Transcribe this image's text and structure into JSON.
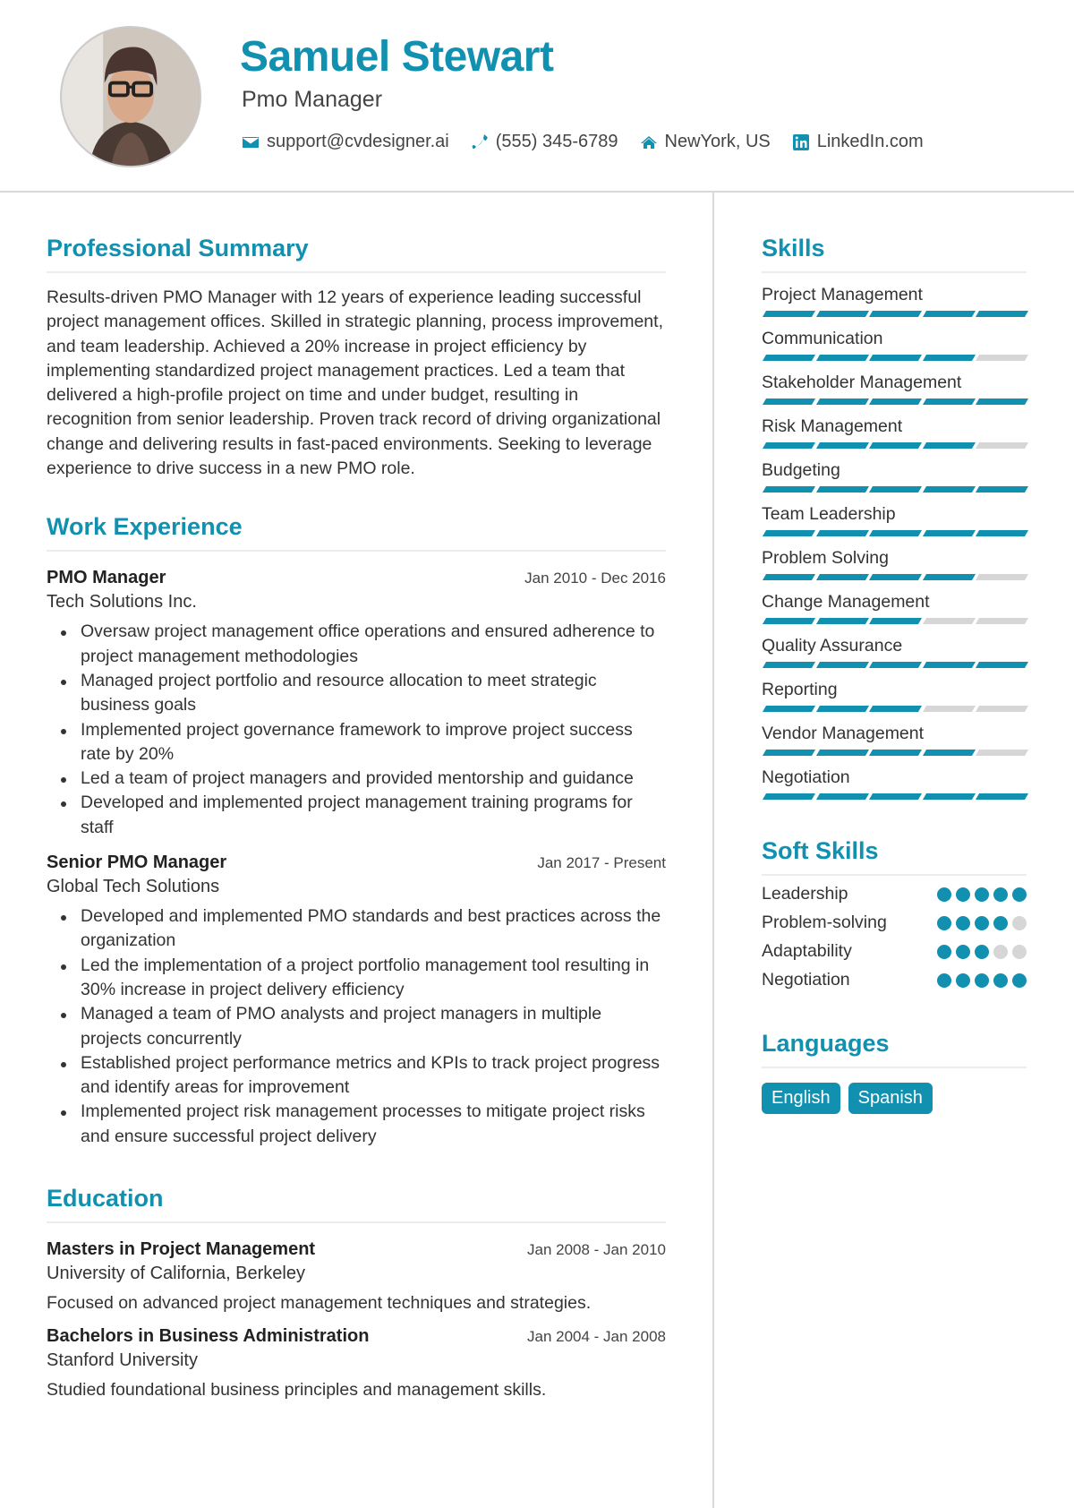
{
  "header": {
    "name": "Samuel Stewart",
    "title": "Pmo Manager",
    "contacts": [
      {
        "icon": "envelope-icon",
        "text": "support@cvdesigner.ai"
      },
      {
        "icon": "phone-icon",
        "text": "(555) 345-6789"
      },
      {
        "icon": "home-icon",
        "text": "NewYork, US"
      },
      {
        "icon": "linkedin-icon",
        "text": "LinkedIn.com"
      }
    ]
  },
  "colors": {
    "accent": "#1190b0",
    "inactive": "#d6d6d6"
  },
  "summary": {
    "heading": "Professional Summary",
    "text": "Results-driven PMO Manager with 12 years of experience leading successful project management offices. Skilled in strategic planning, process improvement, and team leadership. Achieved a 20% increase in project efficiency by implementing standardized project management practices. Led a team that delivered a high-profile project on time and under budget, resulting in recognition from senior leadership. Proven track record of driving organizational change and delivering results in fast-paced environments. Seeking to leverage experience to drive success in a new PMO role."
  },
  "experience": {
    "heading": "Work Experience",
    "jobs": [
      {
        "title": "PMO Manager",
        "date": "Jan 2010 - Dec 2016",
        "company": "Tech Solutions Inc.",
        "bullets": [
          "Oversaw project management office operations and ensured adherence to project management methodologies",
          "Managed project portfolio and resource allocation to meet strategic business goals",
          "Implemented project governance framework to improve project success rate by 20%",
          "Led a team of project managers and provided mentorship and guidance",
          "Developed and implemented project management training programs for staff"
        ]
      },
      {
        "title": "Senior PMO Manager",
        "date": "Jan 2017 - Present",
        "company": "Global Tech Solutions",
        "bullets": [
          "Developed and implemented PMO standards and best practices across the organization",
          "Led the implementation of a project portfolio management tool resulting in 30% increase in project delivery efficiency",
          "Managed a team of PMO analysts and project managers in multiple projects concurrently",
          "Established project performance metrics and KPIs to track project progress and identify areas for improvement",
          "Implemented project risk management processes to mitigate project risks and ensure successful project delivery"
        ]
      }
    ]
  },
  "education": {
    "heading": "Education",
    "items": [
      {
        "degree": "Masters in Project Management",
        "date": "Jan 2008 - Jan 2010",
        "school": "University of California, Berkeley",
        "desc": "Focused on advanced project management techniques and strategies."
      },
      {
        "degree": "Bachelors in Business Administration",
        "date": "Jan 2004 - Jan 2008",
        "school": "Stanford University",
        "desc": "Studied foundational business principles and management skills."
      }
    ]
  },
  "skills": {
    "heading": "Skills",
    "max": 5,
    "items": [
      {
        "name": "Project Management",
        "level": 5
      },
      {
        "name": "Communication",
        "level": 4
      },
      {
        "name": "Stakeholder Management",
        "level": 5
      },
      {
        "name": "Risk Management",
        "level": 4
      },
      {
        "name": "Budgeting",
        "level": 5
      },
      {
        "name": "Team Leadership",
        "level": 5
      },
      {
        "name": "Problem Solving",
        "level": 4
      },
      {
        "name": "Change Management",
        "level": 3
      },
      {
        "name": "Quality Assurance",
        "level": 5
      },
      {
        "name": "Reporting",
        "level": 3
      },
      {
        "name": "Vendor Management",
        "level": 4
      },
      {
        "name": "Negotiation",
        "level": 5
      }
    ]
  },
  "soft_skills": {
    "heading": "Soft Skills",
    "max": 5,
    "items": [
      {
        "name": "Leadership",
        "level": 5
      },
      {
        "name": "Problem-solving",
        "level": 4
      },
      {
        "name": "Adaptability",
        "level": 3
      },
      {
        "name": "Negotiation",
        "level": 5
      }
    ]
  },
  "languages": {
    "heading": "Languages",
    "items": [
      "English",
      "Spanish"
    ]
  }
}
